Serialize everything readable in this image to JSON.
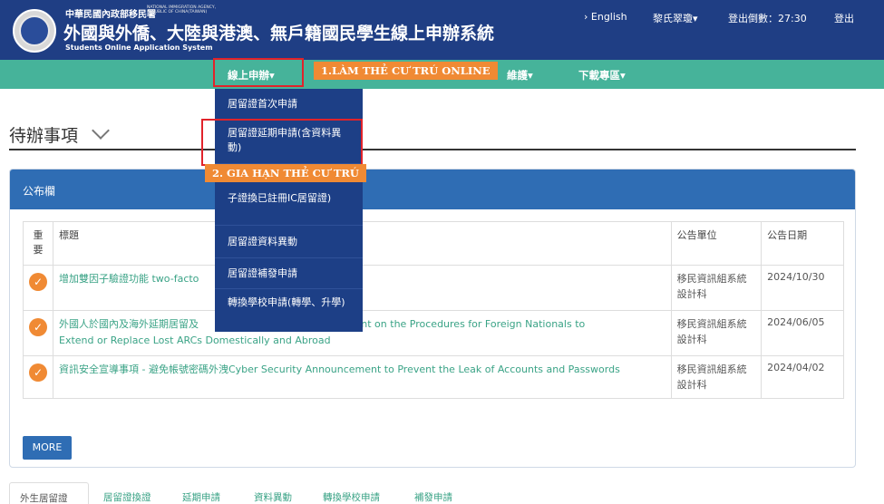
{
  "header": {
    "agency_zh": "中華民國內政部移民署",
    "agency_en": "NATIONAL IMMIGRATION AGENCY, REPUBLIC OF CHINA(TAIWAN)",
    "title": "外國與外僑、大陸與港澳、無戶籍國民學生線上申辦系統",
    "subtitle": "Students Online Application System",
    "english_link": "› English",
    "user": "黎氏翠瓊▾",
    "countdown": "登出倒數：27:30",
    "logout": "登出"
  },
  "nav": {
    "online": "線上申辦▾",
    "maintain": "維護▾",
    "download": "下載專區▾"
  },
  "callouts": {
    "step1": "1.LÀM THẺ CƯ TRÚ ONLINE",
    "step2": "2. GIA HẠN THẺ CƯ TRÚ"
  },
  "dropdown": [
    "居留證首次申請",
    "居留證延期申請(含資料異動)",
    "子證換已註冊IC居留證)",
    "居留證資料異動",
    "居留證補發申請",
    "轉換學校申請(轉學、升學)"
  ],
  "page_title": "待辦事項",
  "panel": {
    "title": "公布欄",
    "headers": [
      "重要",
      "標題",
      "公告單位",
      "公告日期"
    ],
    "rows": [
      {
        "title": "增加雙因子驗證功能 two-facto",
        "unit": "移民資訊組系統設計科",
        "date": "2024/10/30"
      },
      {
        "title_a": "外國人於國內及海外延期居留及",
        "title_b": "ncement on the Procedures for Foreign Nationals to",
        "title_c": "Extend or Replace Lost ARCs Domestically and Abroad",
        "unit": "移民資訊組系統設計科",
        "date": "2024/06/05"
      },
      {
        "title": "資訊安全宣導事項 - 避免帳號密碼外洩Cyber Security Announcement to Prevent the Leak of Accounts and Passwords",
        "unit": "移民資訊組系統設計科",
        "date": "2024/04/02"
      }
    ],
    "more": "MORE"
  },
  "bottom_tabs": [
    "外生居留證",
    "居留證換證",
    "延期申請",
    "資料異動",
    "轉換學校申請",
    "補發申請"
  ],
  "colors": {
    "header_bg": "#1f3e84",
    "nav_bg": "#46b39a",
    "panel_head": "#2f6db4",
    "callout": "#f08a34",
    "highlight": "#e1232a"
  }
}
